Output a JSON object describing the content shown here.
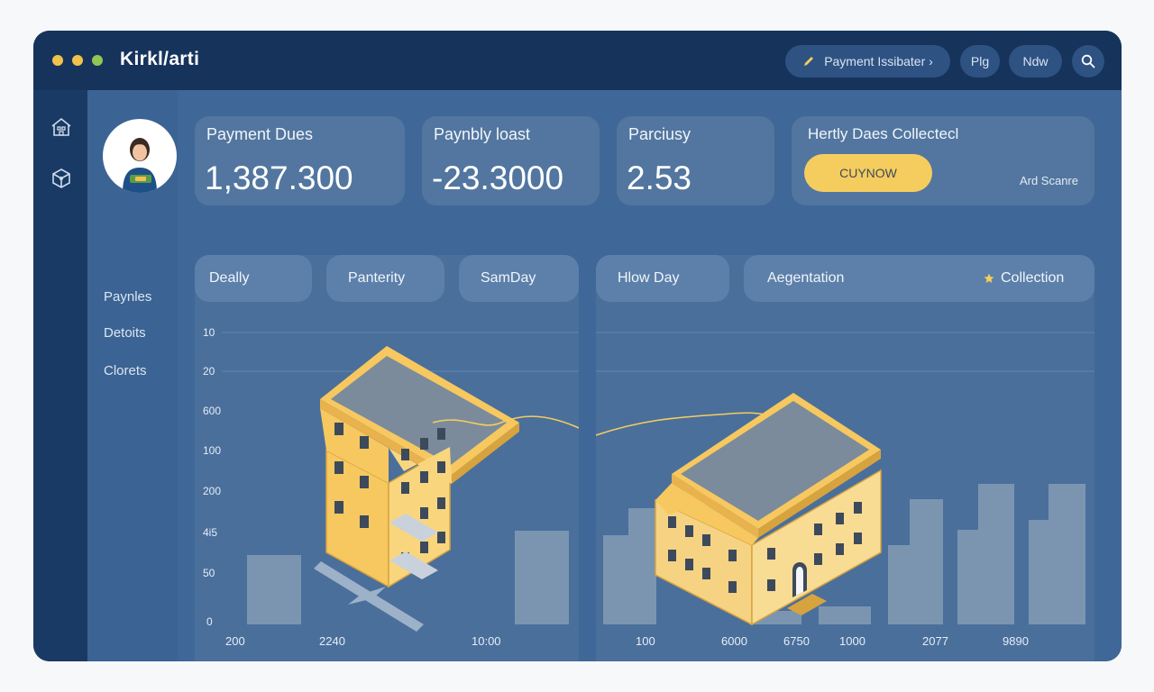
{
  "app": {
    "title": "Kirkl/arti",
    "window_dots": [
      "#f0c24b",
      "#f0c24b",
      "#8fc654"
    ]
  },
  "topbar": {
    "payment_pill": "Payment Issibater ›",
    "pill_2": "Plg",
    "pill_3": "Ndw",
    "search_icon": "search-icon"
  },
  "sidebar": {
    "icons": [
      "building-icon",
      "cube-icon"
    ]
  },
  "subnav": {
    "items": [
      "Paynles",
      "Detoits",
      "Clorets"
    ]
  },
  "cards": [
    {
      "label": "Payment Dues",
      "value": "1,387.300"
    },
    {
      "label": "Paynbly loast",
      "value": "-23.3000"
    },
    {
      "label": "Parciusy",
      "value": "2.53"
    },
    {
      "label": "Hertly Daes Collectecl",
      "button": "CUYNOW",
      "side_text": "Ard Scanre"
    }
  ],
  "left_panel": {
    "tabs": [
      "Deally",
      "Panterity",
      "SamDay"
    ],
    "y_ticks": [
      "10",
      "20",
      "600",
      "100",
      "200",
      "4i5",
      "50",
      "0"
    ],
    "x_ticks": [
      "200",
      "2240",
      "10:00"
    ],
    "progress": 1.0
  },
  "right_panel": {
    "tabs": [
      "Hlow Day",
      "Aegentation"
    ],
    "legend": "Collection",
    "x_ticks": [
      "100",
      "6000",
      "6750",
      "1000",
      "2077",
      "9890"
    ]
  },
  "colors": {
    "accent": "#f5cd5e",
    "navy": "#16335c",
    "panel": "#4a6f9b",
    "building": "#f7d27a"
  }
}
